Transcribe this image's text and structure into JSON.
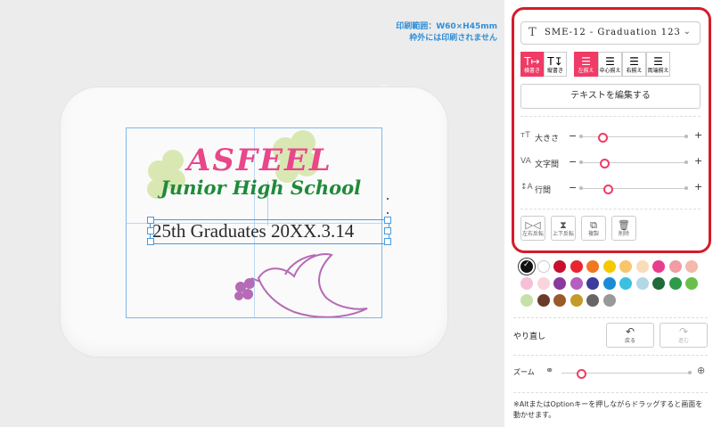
{
  "canvas": {
    "print_note_line1": "印刷範囲：W60×H45mm",
    "print_note_line2": "枠外には印刷されません",
    "title_line1": "ASFEEL",
    "title_line2": "Junior High School",
    "selected_text": "25th Graduates  20XX.3.14",
    "colors": {
      "pink": "#e9468b",
      "green": "#1f8a3a",
      "clover": "#d8e8b0",
      "dove": "#b56bb5"
    }
  },
  "panel": {
    "font_select_value": "SME-12 - Graduation 123",
    "orientation": [
      {
        "icon": "T↦",
        "label": "横書き",
        "active": true
      },
      {
        "icon": "T↧",
        "label": "縦書き",
        "active": false
      }
    ],
    "alignment": [
      {
        "icon": "☰",
        "label": "左揃え",
        "active": true
      },
      {
        "icon": "☰",
        "label": "中心揃え",
        "active": false
      },
      {
        "icon": "☰",
        "label": "右揃え",
        "active": false
      },
      {
        "icon": "☰",
        "label": "両端揃え",
        "active": false
      }
    ],
    "edit_text_button": "テキストを編集する",
    "sliders": [
      {
        "icon": "тT",
        "label": "大きさ",
        "value": 0.2
      },
      {
        "icon": "VA",
        "label": "文字間",
        "value": 0.22
      },
      {
        "icon": "↕A",
        "label": "行間",
        "value": 0.25
      }
    ],
    "minus": "−",
    "plus": "+",
    "actions": [
      {
        "icon": "▷◁",
        "label": "左右反転"
      },
      {
        "icon": "⧗",
        "label": "上下反転"
      },
      {
        "icon": "⧉",
        "label": "複製"
      },
      {
        "icon": "🗑",
        "label": "削除"
      }
    ],
    "accent": "#ef3b66",
    "frame": "#d61c2a"
  },
  "palette": [
    "#111111",
    "#ffffff",
    "#c8102e",
    "#e8262e",
    "#f07820",
    "#f5c800",
    "#f9c56a",
    "#f9dcb8",
    "#e83e8c",
    "#f29ca4",
    "#f4b9ab",
    "#f6bfd6",
    "#f9d4dc",
    "#8a3a9a",
    "#b35ec0",
    "#3c3c9e",
    "#1d8ad6",
    "#3cc0e0",
    "#b3d7e6",
    "#1f6b3a",
    "#2e9a4a",
    "#6abf4b",
    "#c8e0a8",
    "#6b3b2a",
    "#9a5a2a",
    "#c49a2a",
    "#666666",
    "#999999"
  ],
  "history": {
    "label": "やり直し",
    "undo": {
      "icon": "↶",
      "label": "戻る"
    },
    "redo": {
      "icon": "↷",
      "label": "進む"
    }
  },
  "zoom": {
    "label": "ズーム",
    "value": 0.05
  },
  "hint": "※AltまたはOptionキーを押しながらドラッグすると画面を動かせます。"
}
